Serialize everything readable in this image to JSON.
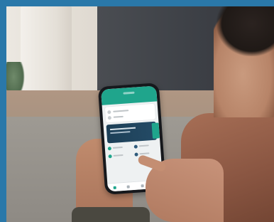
{
  "scene": {
    "description_colors": {
      "frame": "#2a78a9",
      "app_accent": "#1fa58c",
      "banner_dark": "#1d3f57"
    }
  },
  "phone_app": {
    "header_title": "",
    "nav_items": [
      "home-icon",
      "explore-icon",
      "card-icon",
      "settings-icon"
    ]
  }
}
